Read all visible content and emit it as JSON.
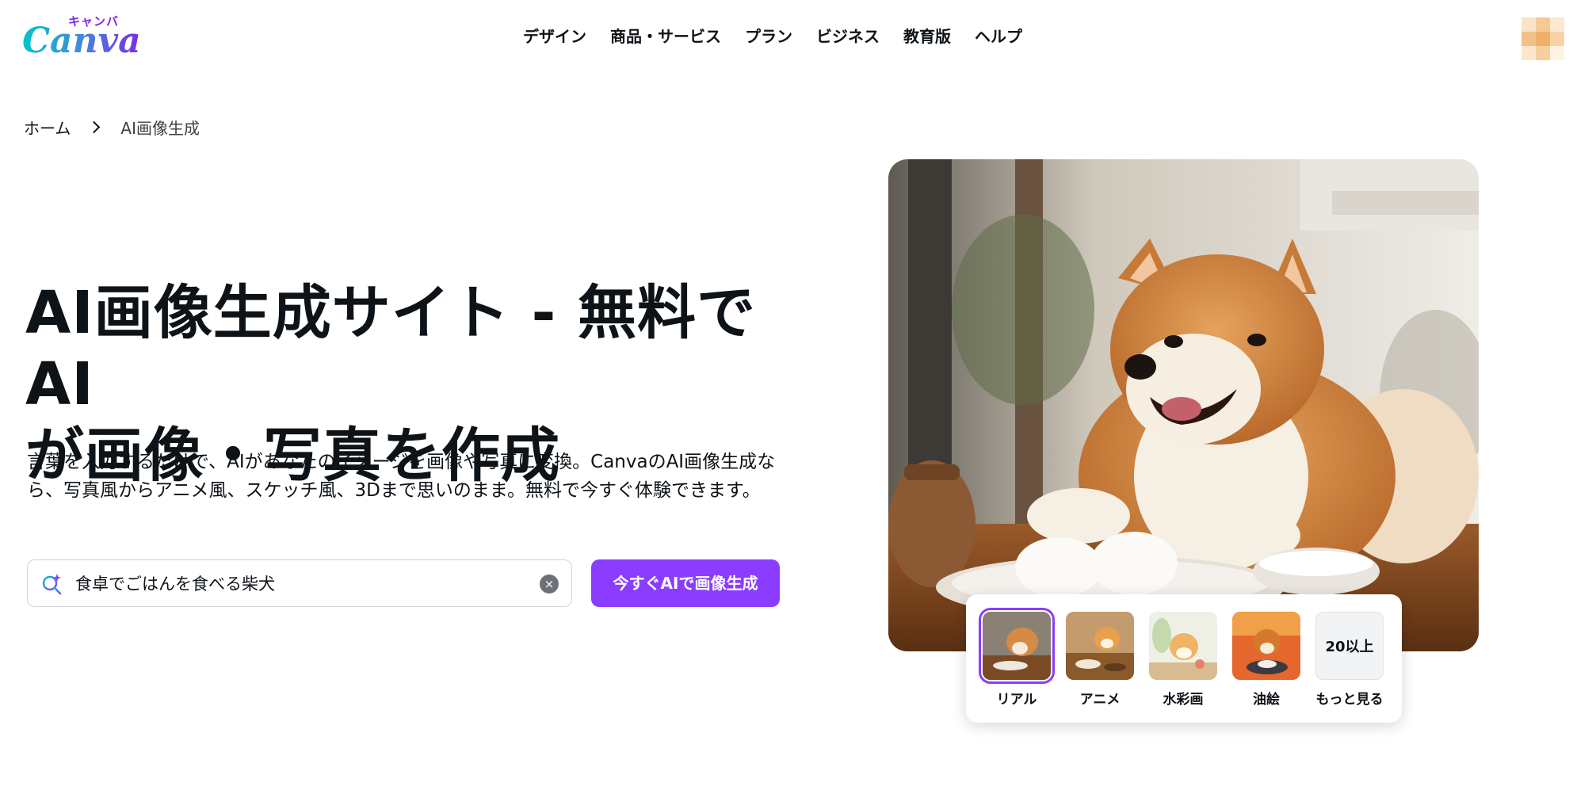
{
  "header": {
    "logo_text": "Canva",
    "logo_jp": "キャンバ",
    "nav": [
      "デザイン",
      "商品・サービス",
      "プラン",
      "ビジネス",
      "教育版",
      "ヘルプ"
    ]
  },
  "breadcrumb": {
    "home": "ホーム",
    "current": "AI画像生成"
  },
  "hero": {
    "title_line1": "AI画像生成サイト - 無料でAI",
    "title_line2": "が画像・写真を作成",
    "description": "言葉を入力するだけで、AIがあなたのイメージを画像や写真に変換。CanvaのAI画像生成なら、写真風からアニメ風、スケッチ風、3Dまで思いのまま。無料で今すぐ体験できます。"
  },
  "search": {
    "value": "食卓でごはんを食べる柴犬",
    "clear_symbol": "×",
    "cta_label": "今すぐAIで画像生成"
  },
  "styles": {
    "options": [
      {
        "label": "リアル",
        "icon": "real-photo-thumbnail",
        "selected": true
      },
      {
        "label": "アニメ",
        "icon": "anime-thumbnail",
        "selected": false
      },
      {
        "label": "水彩画",
        "icon": "watercolor-thumbnail",
        "selected": false
      },
      {
        "label": "油絵",
        "icon": "oil-painting-thumbnail",
        "selected": false
      },
      {
        "label": "もっと見る",
        "icon": "more-styles",
        "selected": false
      }
    ],
    "more_badge": "20以上"
  },
  "colors": {
    "accent": "#8b3dff",
    "text": "#0e1318",
    "logo_gradient_start": "#00c4cc",
    "logo_gradient_end": "#7d2ae8"
  }
}
